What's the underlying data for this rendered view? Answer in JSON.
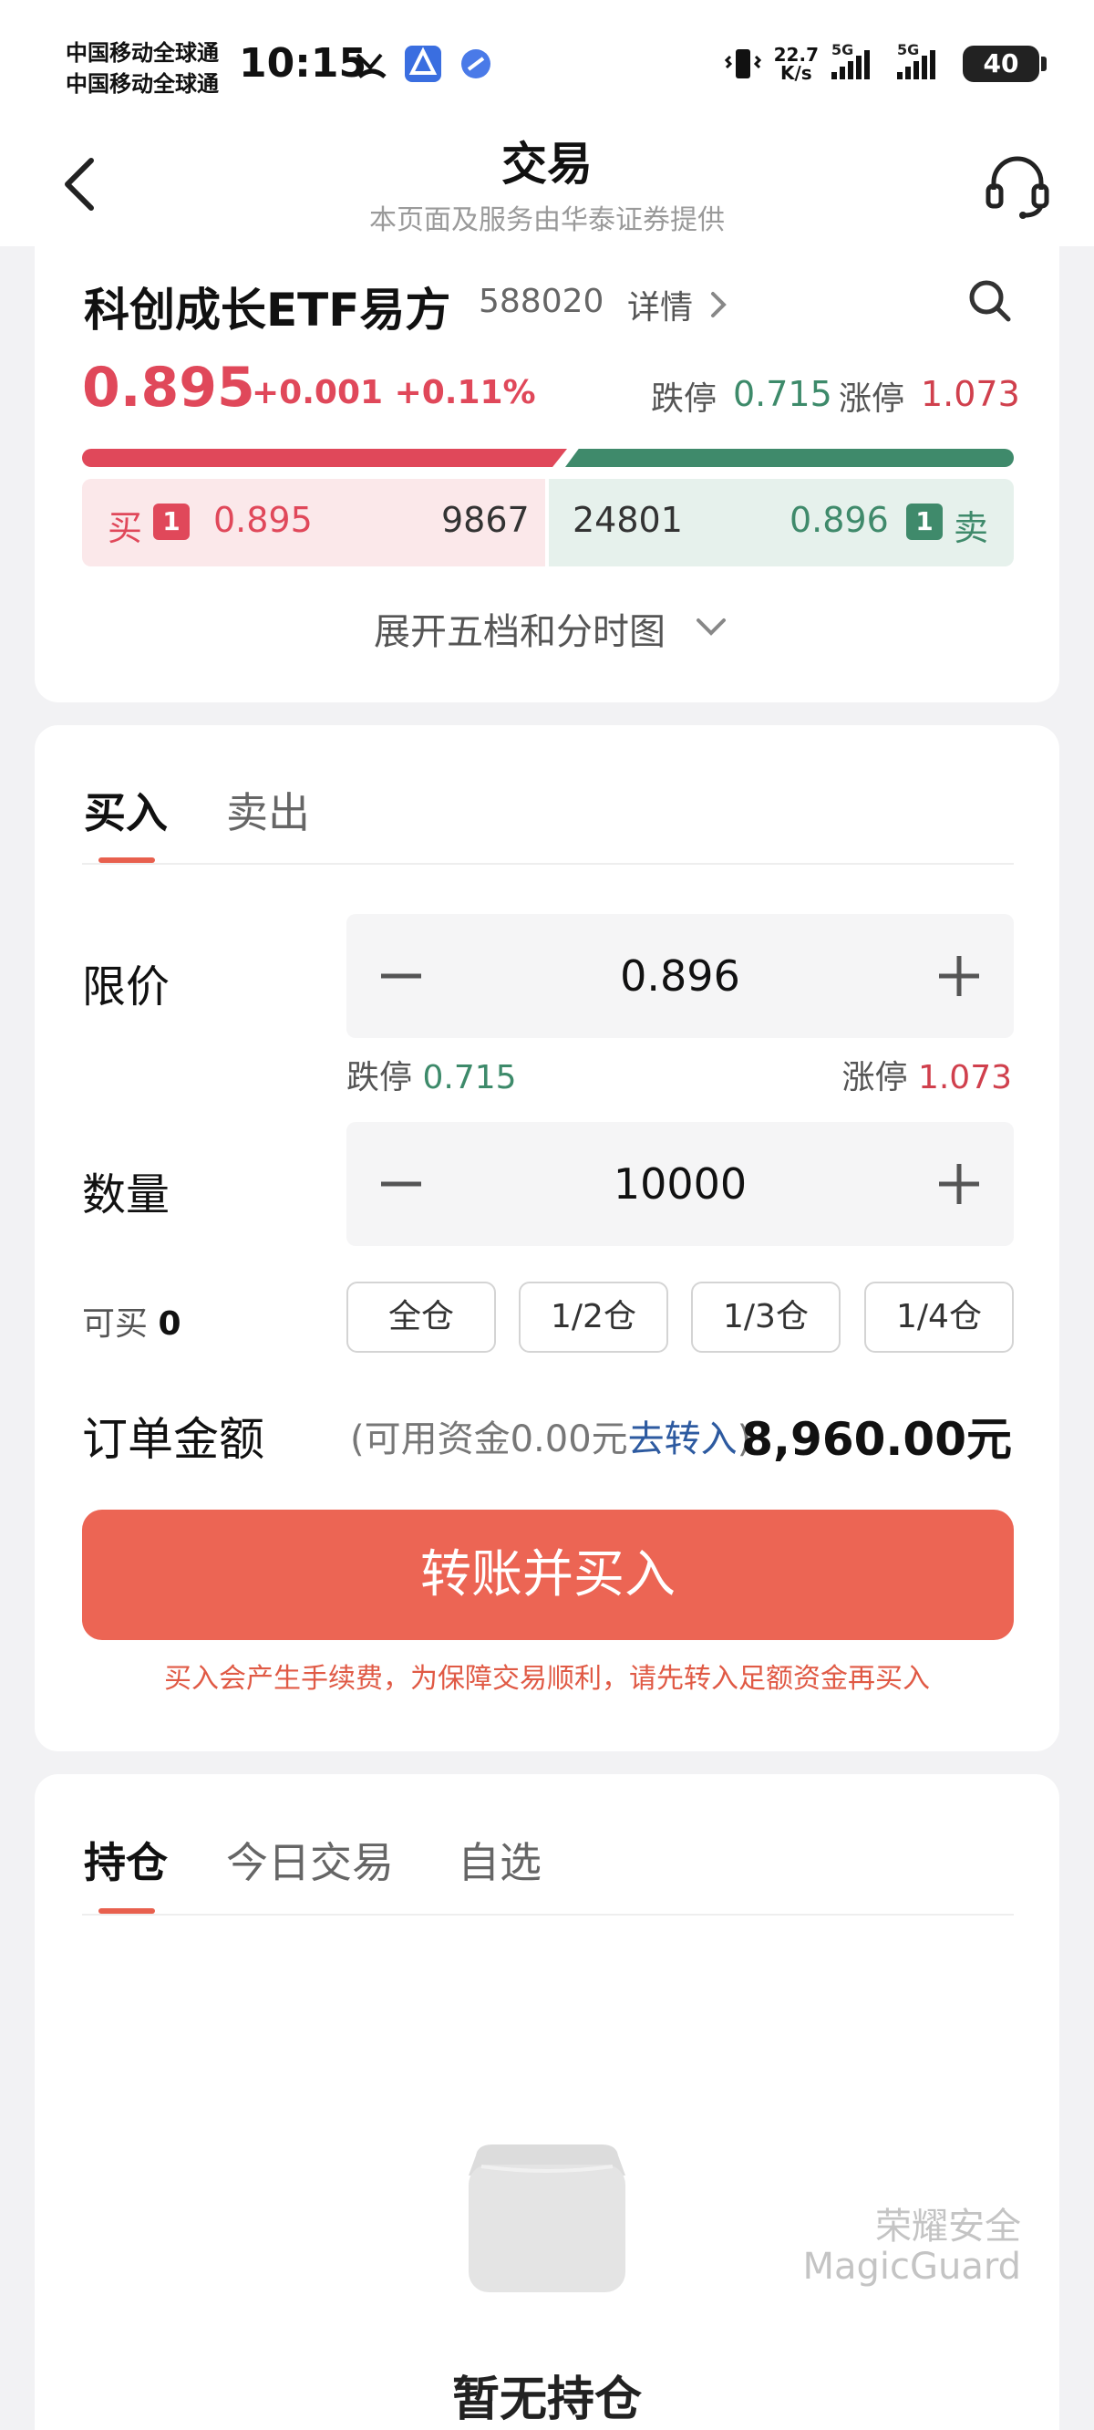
{
  "status_bar": {
    "carrier_1": "中国移动全球通",
    "carrier_2": "中国移动全球通",
    "time": "10:15",
    "net_speed_value": "22.7",
    "net_speed_unit": "K/s",
    "signal_1": "5G",
    "signal_2": "5G",
    "battery": "40"
  },
  "header": {
    "title": "交易",
    "subtitle": "本页面及服务由华泰证券提供"
  },
  "quote": {
    "name": "科创成长ETF易方",
    "code": "588020",
    "detail_label": "详情",
    "price": "0.895",
    "change": "+0.001 +0.11%",
    "limit_down_label": "跌停",
    "limit_down": "0.715",
    "limit_up_label": "涨停",
    "limit_up": "1.073",
    "buy_label": "买",
    "buy_level": "1",
    "buy_price": "0.895",
    "buy_volume": "9867",
    "sell_label": "卖",
    "sell_level": "1",
    "sell_price": "0.896",
    "sell_volume": "24801",
    "expand_label": "展开五档和分时图",
    "colors": {
      "up": "#e0485a",
      "down": "#3f8a6b"
    }
  },
  "trade": {
    "tabs": [
      "买入",
      "卖出"
    ],
    "active_tab": "买入",
    "limit_price_label": "限价",
    "limit_price_value": "0.896",
    "limit_down_label": "跌停",
    "limit_down": "0.715",
    "limit_up_label": "涨停",
    "limit_up": "1.073",
    "quantity_label": "数量",
    "quantity_value": "10000",
    "can_buy_label": "可买",
    "can_buy_value": "0",
    "position_buttons": [
      "全仓",
      "1/2仓",
      "1/3仓",
      "1/4仓"
    ],
    "order_amount_label": "订单金额",
    "fund_hint_prefix": "(可用资金0.00元",
    "fund_hint_link": "去转入",
    "fund_hint_suffix": ")",
    "order_amount": "8,960.00元",
    "submit_label": "转账并买入",
    "fee_warning": "买入会产生手续费，为保障交易顺利，请先转入足额资金再买入",
    "accent_color": "#ec6554"
  },
  "holdings": {
    "tabs": [
      "持仓",
      "今日交易",
      "自选"
    ],
    "active_tab": "持仓",
    "empty_text": "暂无持仓",
    "watermark_line1": "荣耀安全",
    "watermark_line2": "MagicGuard"
  }
}
